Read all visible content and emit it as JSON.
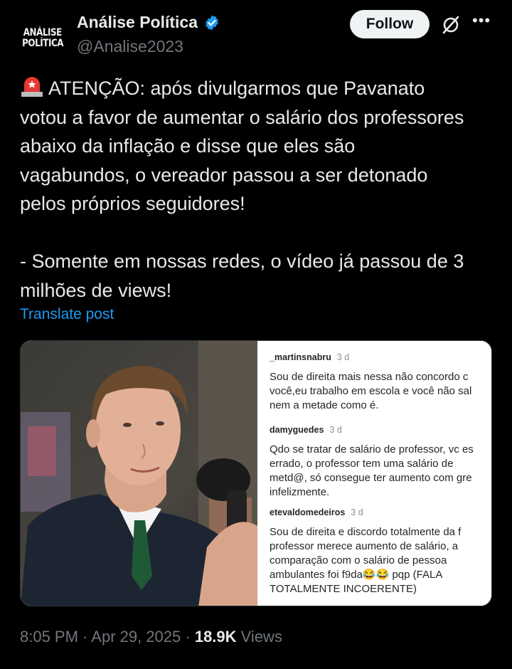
{
  "author": {
    "avatar_line1": "ANÁLISE",
    "avatar_line2": "POLÍTICA",
    "name": "Análise Política",
    "handle": "@Analise2023",
    "verified_icon": "verified-badge-icon"
  },
  "actions": {
    "follow_label": "Follow",
    "grok_icon": "grok-icon",
    "more_icon": "more-dots-icon"
  },
  "post": {
    "emoji_icon": "police-siren-icon",
    "text": "ATENÇÃO: após divulgarmos que Pavanato\nvotou a favor de aumentar o salário dos professores\nabaixo da inflação e disse que eles são\nvagabundos, o vereador passou a ser detonado\npelos próprios seguidores!\n\n- Somente em nossas redes, o vídeo já passou de 3\nmilhões de views!",
    "translate_label": "Translate post"
  },
  "media": {
    "comments": [
      {
        "user": "_martinsnabru",
        "time": "3 d",
        "text": "Sou de direita mais nessa não concordo c\nvocê,eu trabalho em escola e você não sal\nnem a metade como é."
      },
      {
        "user": "damyguedes",
        "time": "3 d",
        "text": "Qdo se tratar de salário de professor, vc es\nerrado, o professor tem uma salário de\nmetd@, só consegue ter aumento com gre\ninfelizmente."
      },
      {
        "user": "etevaldomedeiros",
        "time": "3 d",
        "text": "Sou de direita e discordo totalmente da f\nprofessor merece aumento de salário, a\ncomparação com o salário de pessoa\nambulantes foi f9da😂😂 pqp (FALA\nTOTALMENTE INCOERENTE)"
      }
    ]
  },
  "meta": {
    "time": "8:05 PM",
    "sep1": " · ",
    "date": "Apr 29, 2025",
    "sep2": " · ",
    "views_count": "18.9K",
    "views_label": " Views"
  }
}
